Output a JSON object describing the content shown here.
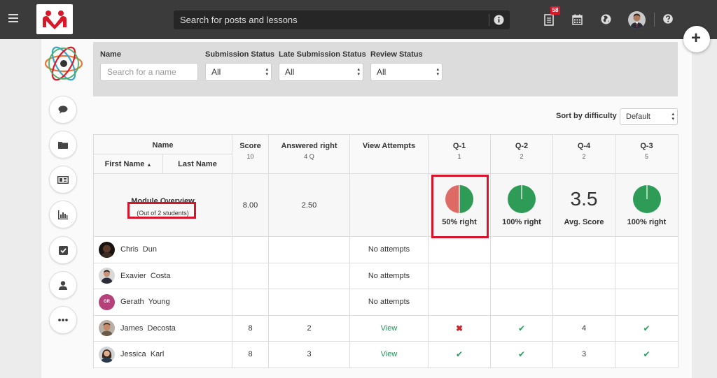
{
  "topbar": {
    "search_placeholder": "Search for posts and lessons",
    "notification_count": "58"
  },
  "filters": {
    "name_label": "Name",
    "name_placeholder": "Search for a name",
    "submission_label": "Submission Status",
    "submission_value": "All",
    "late_label": "Late Submission Status",
    "late_value": "All",
    "review_label": "Review Status",
    "review_value": "All"
  },
  "sort": {
    "label": "Sort by difficulty",
    "value": "Default"
  },
  "table": {
    "name_header": "Name",
    "first_name": "First Name",
    "last_name": "Last Name",
    "score_header": "Score",
    "score_max": "10",
    "answered_header": "Answered right",
    "answered_sub": "4 Q",
    "view_header": "View Attempts",
    "questions": [
      {
        "label": "Q-1",
        "weight": "1"
      },
      {
        "label": "Q-2",
        "weight": "2"
      },
      {
        "label": "Q-4",
        "weight": "2"
      },
      {
        "label": "Q-3",
        "weight": "5"
      }
    ],
    "overview": {
      "title": "Module Overview",
      "subtitle": "(Out of 2 students)",
      "score": "8.00",
      "answered": "2.50",
      "q1_caption": "50% right",
      "q1_fraction": 0.5,
      "q2_caption": "100% right",
      "q2_fraction": 1.0,
      "q4_value": "3.5",
      "q4_caption": "Avg. Score",
      "q3_caption": "100% right",
      "q3_fraction": 1.0
    },
    "students": [
      {
        "first": "Chris",
        "last": "Dun",
        "score": "",
        "answered": "",
        "view": "No attempts",
        "q1": "",
        "q2": "",
        "q4": "",
        "q3": ""
      },
      {
        "first": "Exavier",
        "last": "Costa",
        "score": "",
        "answered": "",
        "view": "No attempts",
        "q1": "",
        "q2": "",
        "q4": "",
        "q3": ""
      },
      {
        "first": "Gerath",
        "last": "Young",
        "initials": "GR",
        "score": "",
        "answered": "",
        "view": "No attempts",
        "q1": "",
        "q2": "",
        "q4": "",
        "q3": ""
      },
      {
        "first": "James",
        "last": "Decosta",
        "score": "8",
        "answered": "2",
        "view": "View",
        "q1": "cross",
        "q2": "check",
        "q4": "4",
        "q3": "check"
      },
      {
        "first": "Jessica",
        "last": "Karl",
        "score": "8",
        "answered": "3",
        "view": "View",
        "q1": "check",
        "q2": "check",
        "q4": "3",
        "q3": "check"
      }
    ]
  },
  "colors": {
    "topbar": "#3b3b3b",
    "brand_red": "#d9182a",
    "pie_green": "#2e9b57",
    "pie_red": "#de6a66",
    "highlight": "#d6142a"
  }
}
